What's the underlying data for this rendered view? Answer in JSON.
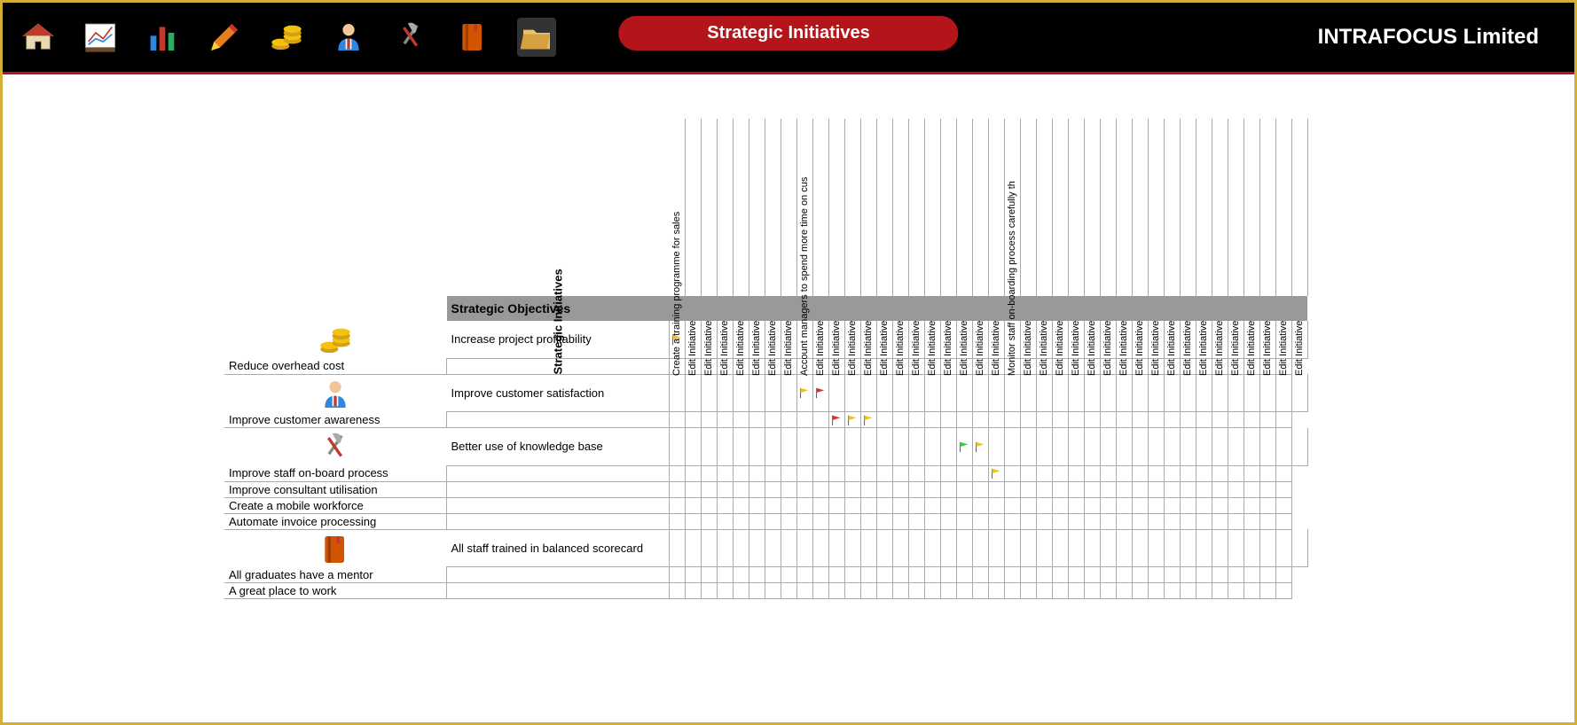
{
  "header": {
    "title": "Strategic  Initiatives",
    "brand": "INTRAFOCUS Limited",
    "toolbar": [
      {
        "name": "home-icon",
        "label": "Home"
      },
      {
        "name": "chart-icon",
        "label": "Chart"
      },
      {
        "name": "bars-icon",
        "label": "Bars"
      },
      {
        "name": "pencil-icon",
        "label": "Edit"
      },
      {
        "name": "coins-icon",
        "label": "Finance"
      },
      {
        "name": "person-icon",
        "label": "People"
      },
      {
        "name": "tools-icon",
        "label": "Tools"
      },
      {
        "name": "book-icon",
        "label": "Book"
      },
      {
        "name": "folder-icon",
        "label": "Folder"
      }
    ]
  },
  "matrix": {
    "corner_label": "Strategic Initiatives",
    "columns": [
      "Create a training programme for sales",
      "Edit Initiative",
      "Edit Initiative",
      "Edit Initiative",
      "Edit Initiative",
      "Edit Initiative",
      "Edit Initiative",
      "Edit Initiative",
      "Account managers to spend more time on cus",
      "Edit Initiative",
      "Edit Initiative",
      "Edit Initiative",
      "Edit Initiative",
      "Edit Initiative",
      "Edit Initiative",
      "Edit Initiative",
      "Edit Initiative",
      "Edit Initiative",
      "Edit Initiative",
      "Edit Initiative",
      "Edit Initiative",
      "Monitor staff on-boarding process carefully th",
      "Edit Initiative",
      "Edit Initiative",
      "Edit Initiative",
      "Edit Initiative",
      "Edit Initiative",
      "Edit Initiative",
      "Edit Initiative",
      "Edit Initiative",
      "Edit Initiative",
      "Edit Initiative",
      "Edit Initiative",
      "Edit Initiative",
      "Edit Initiative",
      "Edit Initiative",
      "Edit Initiative",
      "Edit Initiative",
      "Edit Initiative",
      "Edit Initiative"
    ],
    "section_header": "Strategic Objectives",
    "groups": [
      {
        "icon": "coins-icon",
        "rows": [
          {
            "label": "Increase project profitability",
            "flags": {
              "0": "y"
            }
          },
          {
            "label": "Reduce overhead cost",
            "flags": {}
          }
        ]
      },
      {
        "icon": "person-icon",
        "rows": [
          {
            "label": "Improve customer satisfaction",
            "flags": {
              "8": "y",
              "9": "r"
            }
          },
          {
            "label": "Improve customer awareness",
            "flags": {
              "11": "r",
              "12": "y",
              "13": "y"
            }
          }
        ]
      },
      {
        "icon": "tools-icon",
        "rows": [
          {
            "label": "Better use of knowledge base",
            "flags": {
              "18": "g",
              "19": "y"
            }
          },
          {
            "label": "Improve staff on-board process",
            "flags": {
              "21": "y"
            }
          },
          {
            "label": "Improve consultant utilisation",
            "flags": {}
          },
          {
            "label": "Create a mobile workforce",
            "flags": {}
          },
          {
            "label": "Automate invoice processing",
            "flags": {}
          }
        ]
      },
      {
        "icon": "book-icon",
        "rows": [
          {
            "label": "All staff trained in balanced scorecard",
            "flags": {}
          },
          {
            "label": "All graduates have a mentor",
            "flags": {}
          },
          {
            "label": "A great place to work",
            "flags": {}
          }
        ]
      }
    ]
  }
}
